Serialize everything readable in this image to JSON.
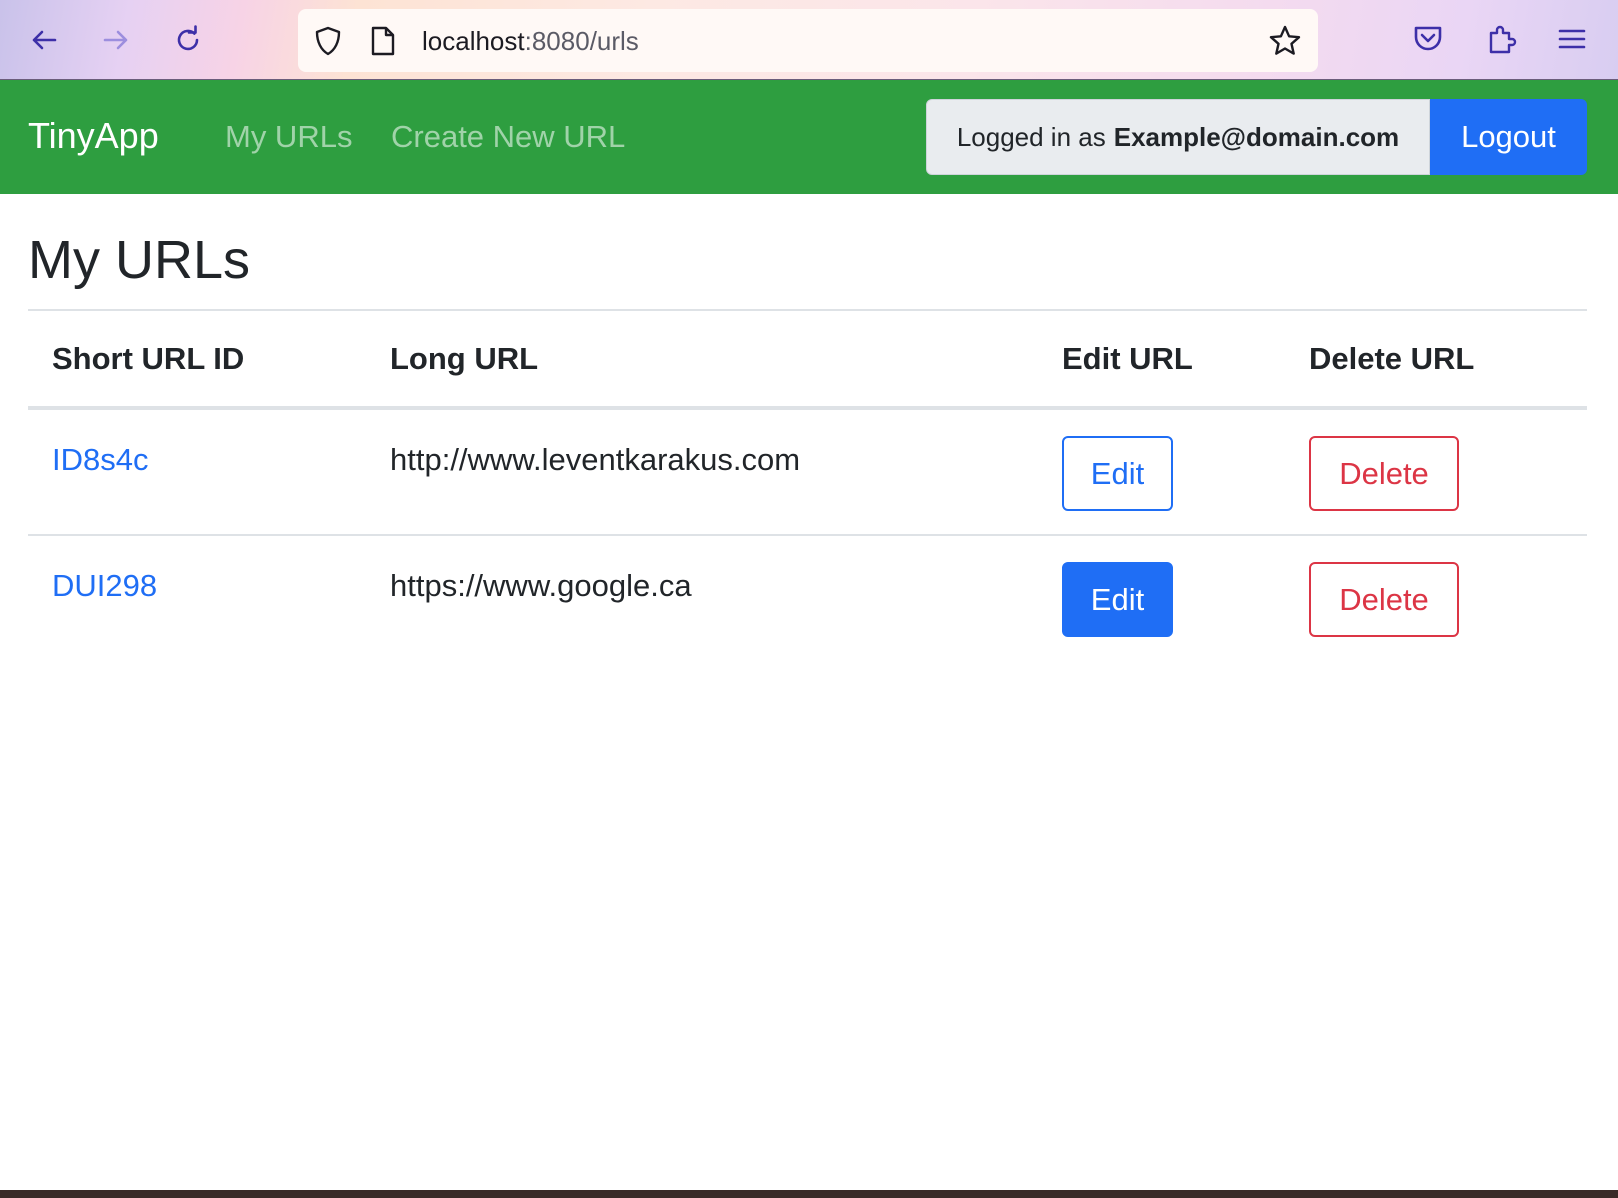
{
  "browser": {
    "url_host": "localhost",
    "url_rest": ":8080/urls",
    "icons": [
      "back-arrow-icon",
      "forward-arrow-icon",
      "reload-icon",
      "shield-icon",
      "page-icon",
      "star-icon",
      "pocket-icon",
      "extensions-icon",
      "menu-icon"
    ]
  },
  "navbar": {
    "brand": "TinyApp",
    "links": [
      "My URLs",
      "Create New URL"
    ],
    "login_prefix": "Logged in as",
    "login_email": "Example@domain.com",
    "logout_label": "Logout",
    "colors": {
      "bar": "#2e9e40",
      "primary": "#1f6ef5",
      "danger": "#dc3545"
    }
  },
  "main": {
    "title": "My URLs",
    "table": {
      "headers": [
        "Short URL ID",
        "Long URL",
        "Edit URL",
        "Delete URL"
      ],
      "rows": [
        {
          "short_id": "ID8s4c",
          "long_url": "http://www.leventkarakus.com",
          "edit_label": "Edit",
          "delete_label": "Delete"
        },
        {
          "short_id": "DUI298",
          "long_url": "https://www.google.ca",
          "edit_label": "Edit",
          "delete_label": "Delete"
        }
      ]
    }
  }
}
